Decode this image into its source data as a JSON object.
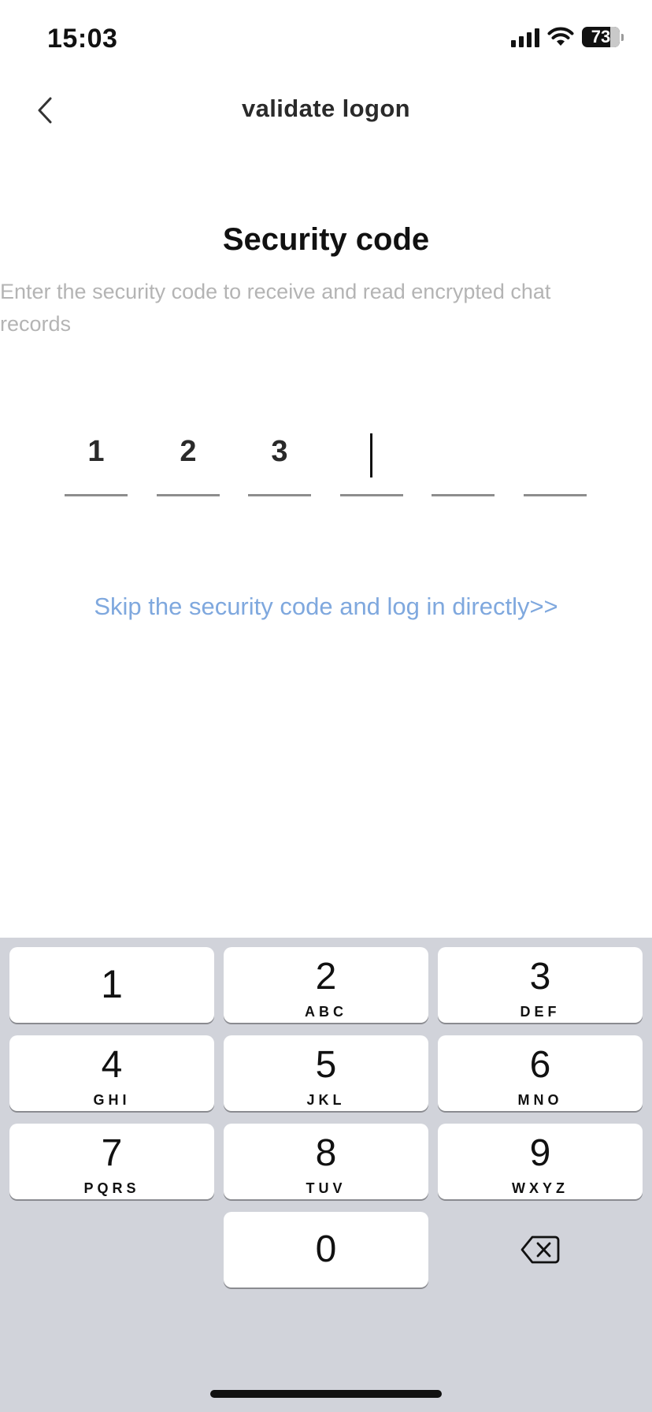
{
  "status_bar": {
    "time": "15:03",
    "battery": "73",
    "icons": [
      "signal-icon",
      "wifi-icon",
      "battery-icon"
    ]
  },
  "nav": {
    "back_icon": "chevron-left-icon",
    "title": "validate logon"
  },
  "content": {
    "heading": "Security code",
    "subtitle": "Enter the security code to receive and read encrypted chat records",
    "code_digits": [
      "1",
      "2",
      "3",
      "",
      "",
      ""
    ],
    "active_index": 3,
    "skip_link": "Skip the security code and log in directly>>"
  },
  "keypad": {
    "keys": [
      {
        "num": "1",
        "letters": ""
      },
      {
        "num": "2",
        "letters": "ABC"
      },
      {
        "num": "3",
        "letters": "DEF"
      },
      {
        "num": "4",
        "letters": "GHI"
      },
      {
        "num": "5",
        "letters": "JKL"
      },
      {
        "num": "6",
        "letters": "MNO"
      },
      {
        "num": "7",
        "letters": "PQRS"
      },
      {
        "num": "8",
        "letters": "TUV"
      },
      {
        "num": "9",
        "letters": "WXYZ"
      },
      {
        "num": "0",
        "letters": ""
      }
    ],
    "delete_icon": "backspace-icon"
  },
  "colors": {
    "link": "#7fa8de",
    "subtitle": "#b4b4b4",
    "keyboard_bg": "#d1d3da"
  }
}
